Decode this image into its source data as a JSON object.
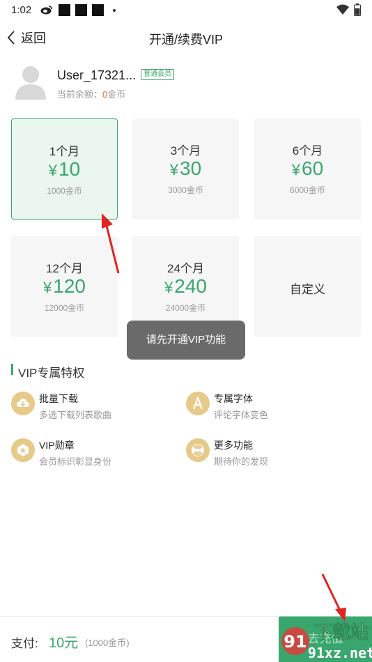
{
  "status_bar": {
    "time": "1:02"
  },
  "header": {
    "back_label": "返回",
    "title": "开通/续费VIP"
  },
  "user": {
    "name": "User_17321...",
    "badge": "普通会员",
    "balance_label": "当前余额：",
    "balance_value": "0",
    "balance_unit": "金币"
  },
  "plans": [
    {
      "duration": "1个月",
      "price": "10",
      "coins": "1000金币",
      "selected": true
    },
    {
      "duration": "3个月",
      "price": "30",
      "coins": "3000金币"
    },
    {
      "duration": "6个月",
      "price": "60",
      "coins": "6000金币"
    },
    {
      "duration": "12个月",
      "price": "120",
      "coins": "12000金币"
    },
    {
      "duration": "24个月",
      "price": "240",
      "coins": "24000金币"
    },
    {
      "custom_label": "自定义"
    }
  ],
  "currency_symbol": "¥",
  "toast": "请先开通VIP功能",
  "privileges": {
    "title": "VIP专属特权",
    "items": [
      {
        "title": "批量下载",
        "desc": "多选下载列表歌曲",
        "icon": "cloud-download-icon"
      },
      {
        "title": "专属字体",
        "desc": "评论字体变色",
        "icon": "font-a-icon"
      },
      {
        "title": "VIP勋章",
        "desc": "会员标识彰显身份",
        "icon": "medal-icon"
      },
      {
        "title": "更多功能",
        "desc": "期待你的发现",
        "icon": "more-features-icon"
      }
    ]
  },
  "bottom": {
    "pay_label": "支付:",
    "pay_amount": "10元",
    "pay_coins": "(1000金币)",
    "recharge_label": "去充值"
  },
  "watermark": {
    "text_top": "下载站",
    "text_bottom": "91xz.net"
  },
  "colors": {
    "accent": "#3aa76d",
    "highlight": "#f26a2b",
    "annotation": "#e02424"
  }
}
